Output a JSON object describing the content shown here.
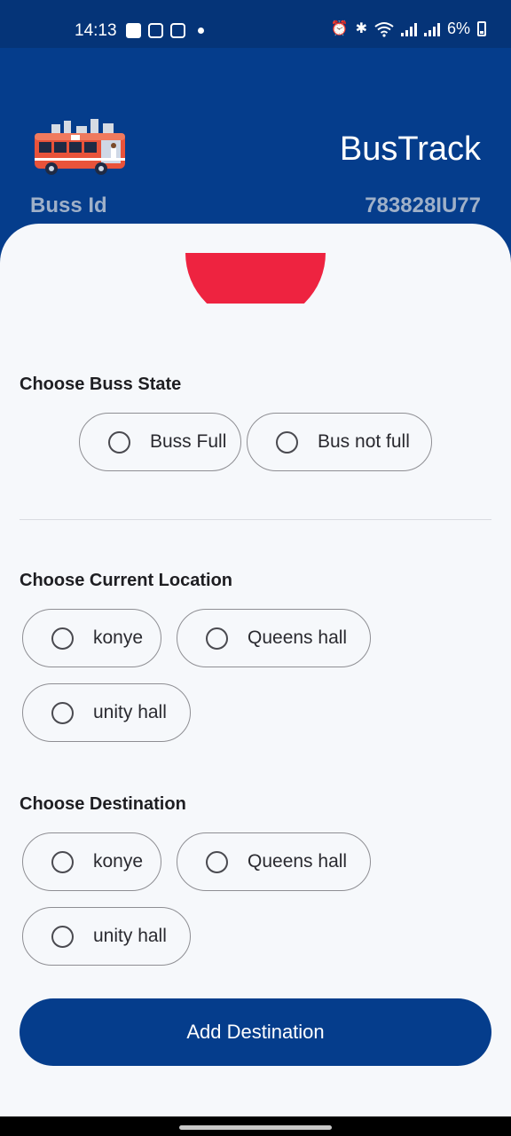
{
  "status_bar": {
    "time": "14:13",
    "left_icons": [
      "gallery-icon",
      "instagram-icon",
      "instagram-icon",
      "notification-dot-icon"
    ],
    "right_icons": [
      "alarm-icon",
      "bluetooth-icon",
      "wifi-icon",
      "signal-icon",
      "signal-icon"
    ],
    "battery": "6%"
  },
  "header": {
    "app_title": "BusTrack",
    "bus_id_label": "Buss Id",
    "bus_id_value": "783828IU77"
  },
  "bus_state": {
    "title": "Choose Buss State",
    "options": [
      "Buss Full",
      "Bus not full"
    ]
  },
  "current_location": {
    "title": "Choose Current Location",
    "options": [
      "konye",
      "Queens hall",
      "unity hall"
    ]
  },
  "destination": {
    "title": "Choose Destination",
    "options": [
      "konye",
      "Queens hall",
      "unity hall"
    ]
  },
  "actions": {
    "add_destination": "Add Destination"
  },
  "colors": {
    "primary": "#053d8c",
    "status_bar": "#053478",
    "background": "#f6f8fb",
    "accent_red": "#ee2340",
    "muted_text": "#9fb0c8"
  }
}
